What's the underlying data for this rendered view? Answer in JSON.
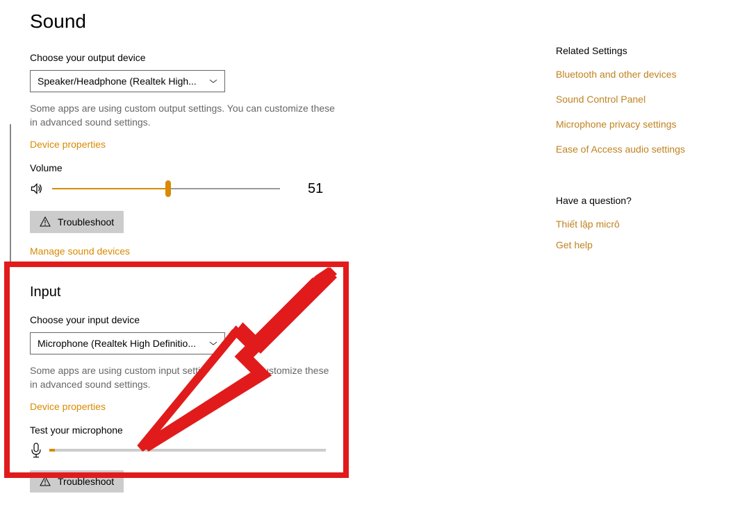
{
  "page_title": "Sound",
  "output": {
    "choose_label": "Choose your output device",
    "selected_device": "Speaker/Headphone (Realtek High...",
    "description": "Some apps are using custom output settings. You can customize these in advanced sound settings.",
    "device_properties_link": "Device properties",
    "volume_label": "Volume",
    "volume_value": "51",
    "volume_percent": 51,
    "troubleshoot_label": "Troubleshoot",
    "manage_devices_link": "Manage sound devices"
  },
  "input": {
    "section_title": "Input",
    "choose_label": "Choose your input device",
    "selected_device": "Microphone (Realtek High Definitio...",
    "description": "Some apps are using custom input settings. You can customize these in advanced sound settings.",
    "device_properties_link": "Device properties",
    "test_label": "Test your microphone",
    "mic_level_percent": 2,
    "troubleshoot_label": "Troubleshoot"
  },
  "related": {
    "heading": "Related Settings",
    "links": [
      "Bluetooth and other devices",
      "Sound Control Panel",
      "Microphone privacy settings",
      "Ease of Access audio settings"
    ]
  },
  "help": {
    "heading": "Have a question?",
    "links": [
      "Thiết lập micrô",
      "Get help"
    ]
  }
}
